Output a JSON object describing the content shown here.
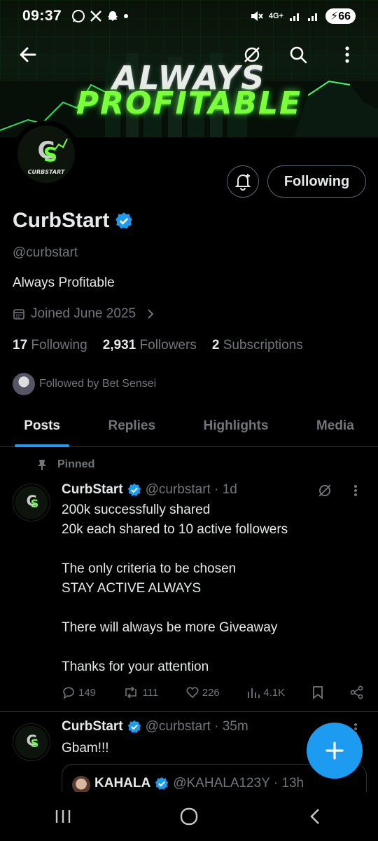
{
  "status_bar": {
    "time": "09:37",
    "network": "4G+",
    "battery": "66",
    "notification_icons": [
      "whatsapp-icon",
      "x-icon",
      "snapchat-icon",
      "dot-icon"
    ]
  },
  "banner": {
    "line1": "ALWAYS",
    "line2": "PROFITABLE"
  },
  "profile": {
    "avatar_text": "CURBSTART",
    "name": "CurbStart",
    "handle": "@curbstart",
    "bio": "Always Profitable",
    "joined": "Joined June 2025",
    "following_count": "17",
    "following_label": "Following",
    "followers_count": "2,931",
    "followers_label": "Followers",
    "subscriptions_count": "2",
    "subscriptions_label": "Subscriptions",
    "followed_by": "Followed by Bet Sensei",
    "follow_button": "Following"
  },
  "tabs": [
    {
      "label": "Posts",
      "active": true
    },
    {
      "label": "Replies",
      "active": false
    },
    {
      "label": "Highlights",
      "active": false
    },
    {
      "label": "Media",
      "active": false
    }
  ],
  "posts": [
    {
      "pinned_label": "Pinned",
      "name": "CurbStart",
      "handle_time": "@curbstart · 1d",
      "text": "200k successfully shared\n20k each shared to 10 active followers\n\nThe only criteria to be chosen\nSTAY ACTIVE ALWAYS\n\nThere will always be more Giveaway\n\nThanks for your attention",
      "replies": "149",
      "reposts": "111",
      "likes": "226",
      "views": "4.1K"
    },
    {
      "name": "CurbStart",
      "handle_time": "@curbstart · 35m",
      "text": "Gbam!!!",
      "quote": {
        "name": "KAHALA",
        "handle_time": "@KAHALA123Y · 13h"
      }
    }
  ],
  "colors": {
    "accent": "#1d9bf0",
    "banner_green": "#7bff3a",
    "muted": "#71767b",
    "text": "#e7e9ea",
    "border": "#2f3336"
  }
}
